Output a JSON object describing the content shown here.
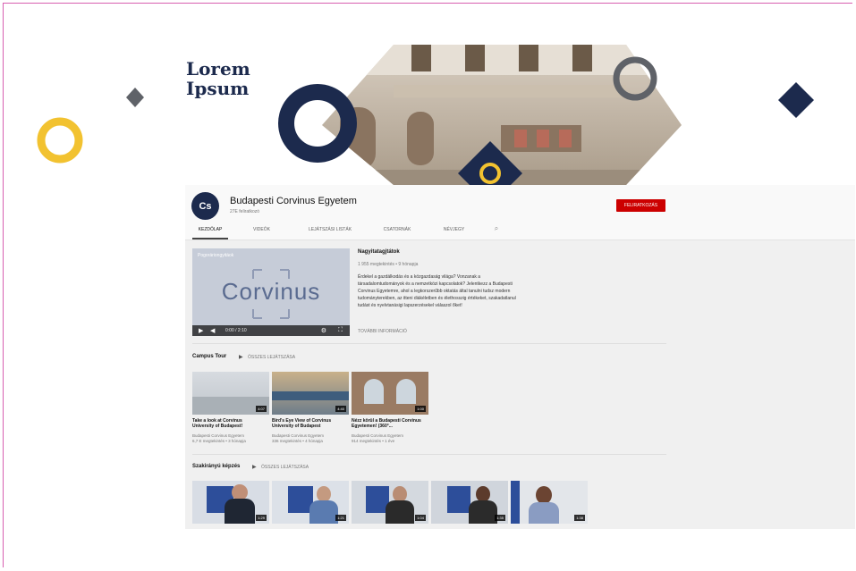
{
  "brand": {
    "line1": "Lorem",
    "line2": "Ipsum"
  },
  "colors": {
    "navy": "#1c2a4d",
    "yellow": "#f2c230",
    "grey": "#5f6268",
    "red": "#cc0000"
  },
  "channel": {
    "name": "Budapesti Corvinus Egyetem",
    "subscribers": "27E feliratkozó",
    "avatar_text": "Cs",
    "subscribe_label": "FELIRATKOZÁS"
  },
  "tabs": [
    "KEZDŐLAP",
    "VIDEÓK",
    "LEJÁTSZÁSI LISTÁK",
    "CSATORNÁK",
    "NÉVJEGY"
  ],
  "featured": {
    "player_title": "Pogoráriongyitáok",
    "player_logo": "Corvinus",
    "player_time": "0:00 / 2:10",
    "title": "Nagyitatagjtátok",
    "meta": "1 955 megtekintés • 9 hónapja",
    "description": "Érdekel a gazdálkodás és a közgazdaság világa? Vonzanak a társadalomtudományok és a nemzetközi kapcsolatok? Jelentkezz a Budapesti Corvinus Egyetemre, ahol a legkorszerűbb oktatás által tanulni tudsz modern tudományterekben, az itteni diákéletben és élethosszig értékeket, szakadatlanul tudást és nyelvtanásigi lapszerzésekel válaszol őket!",
    "more": "TOVÁBBI INFORMÁCIÓ"
  },
  "sections": [
    {
      "title": "Campus Tour",
      "link": "ÖSSZES LEJÁTSZÁSA",
      "videos": [
        {
          "title": "Take a look at Corvinus University of Budapest!",
          "channel": "Budapesti Corvinus Egyetem",
          "meta": "6,7 E megtekintés • 3 hónapja",
          "duration": "4:07"
        },
        {
          "title": "Bird's Eye View of Corvinus University of Budapest",
          "channel": "Budapesti Corvinus Egyetem",
          "meta": "336 megtekintés • 4 hónapja",
          "duration": "4:40"
        },
        {
          "title": "Nézz körül a Budapesti Corvinus Egyetemen! (360°...",
          "channel": "Budapesti Corvinus Egyetem",
          "meta": "914 megtekintés • 1 éve",
          "duration": "1:00"
        }
      ]
    },
    {
      "title": "Szakirányú képzés",
      "link": "ÖSSZES LEJÁTSZÁSA",
      "videos": [
        {
          "duration": "1:29"
        },
        {
          "duration": "1:21"
        },
        {
          "duration": "1:04"
        },
        {
          "duration": "1:35"
        },
        {
          "duration": "1:38"
        }
      ]
    }
  ]
}
